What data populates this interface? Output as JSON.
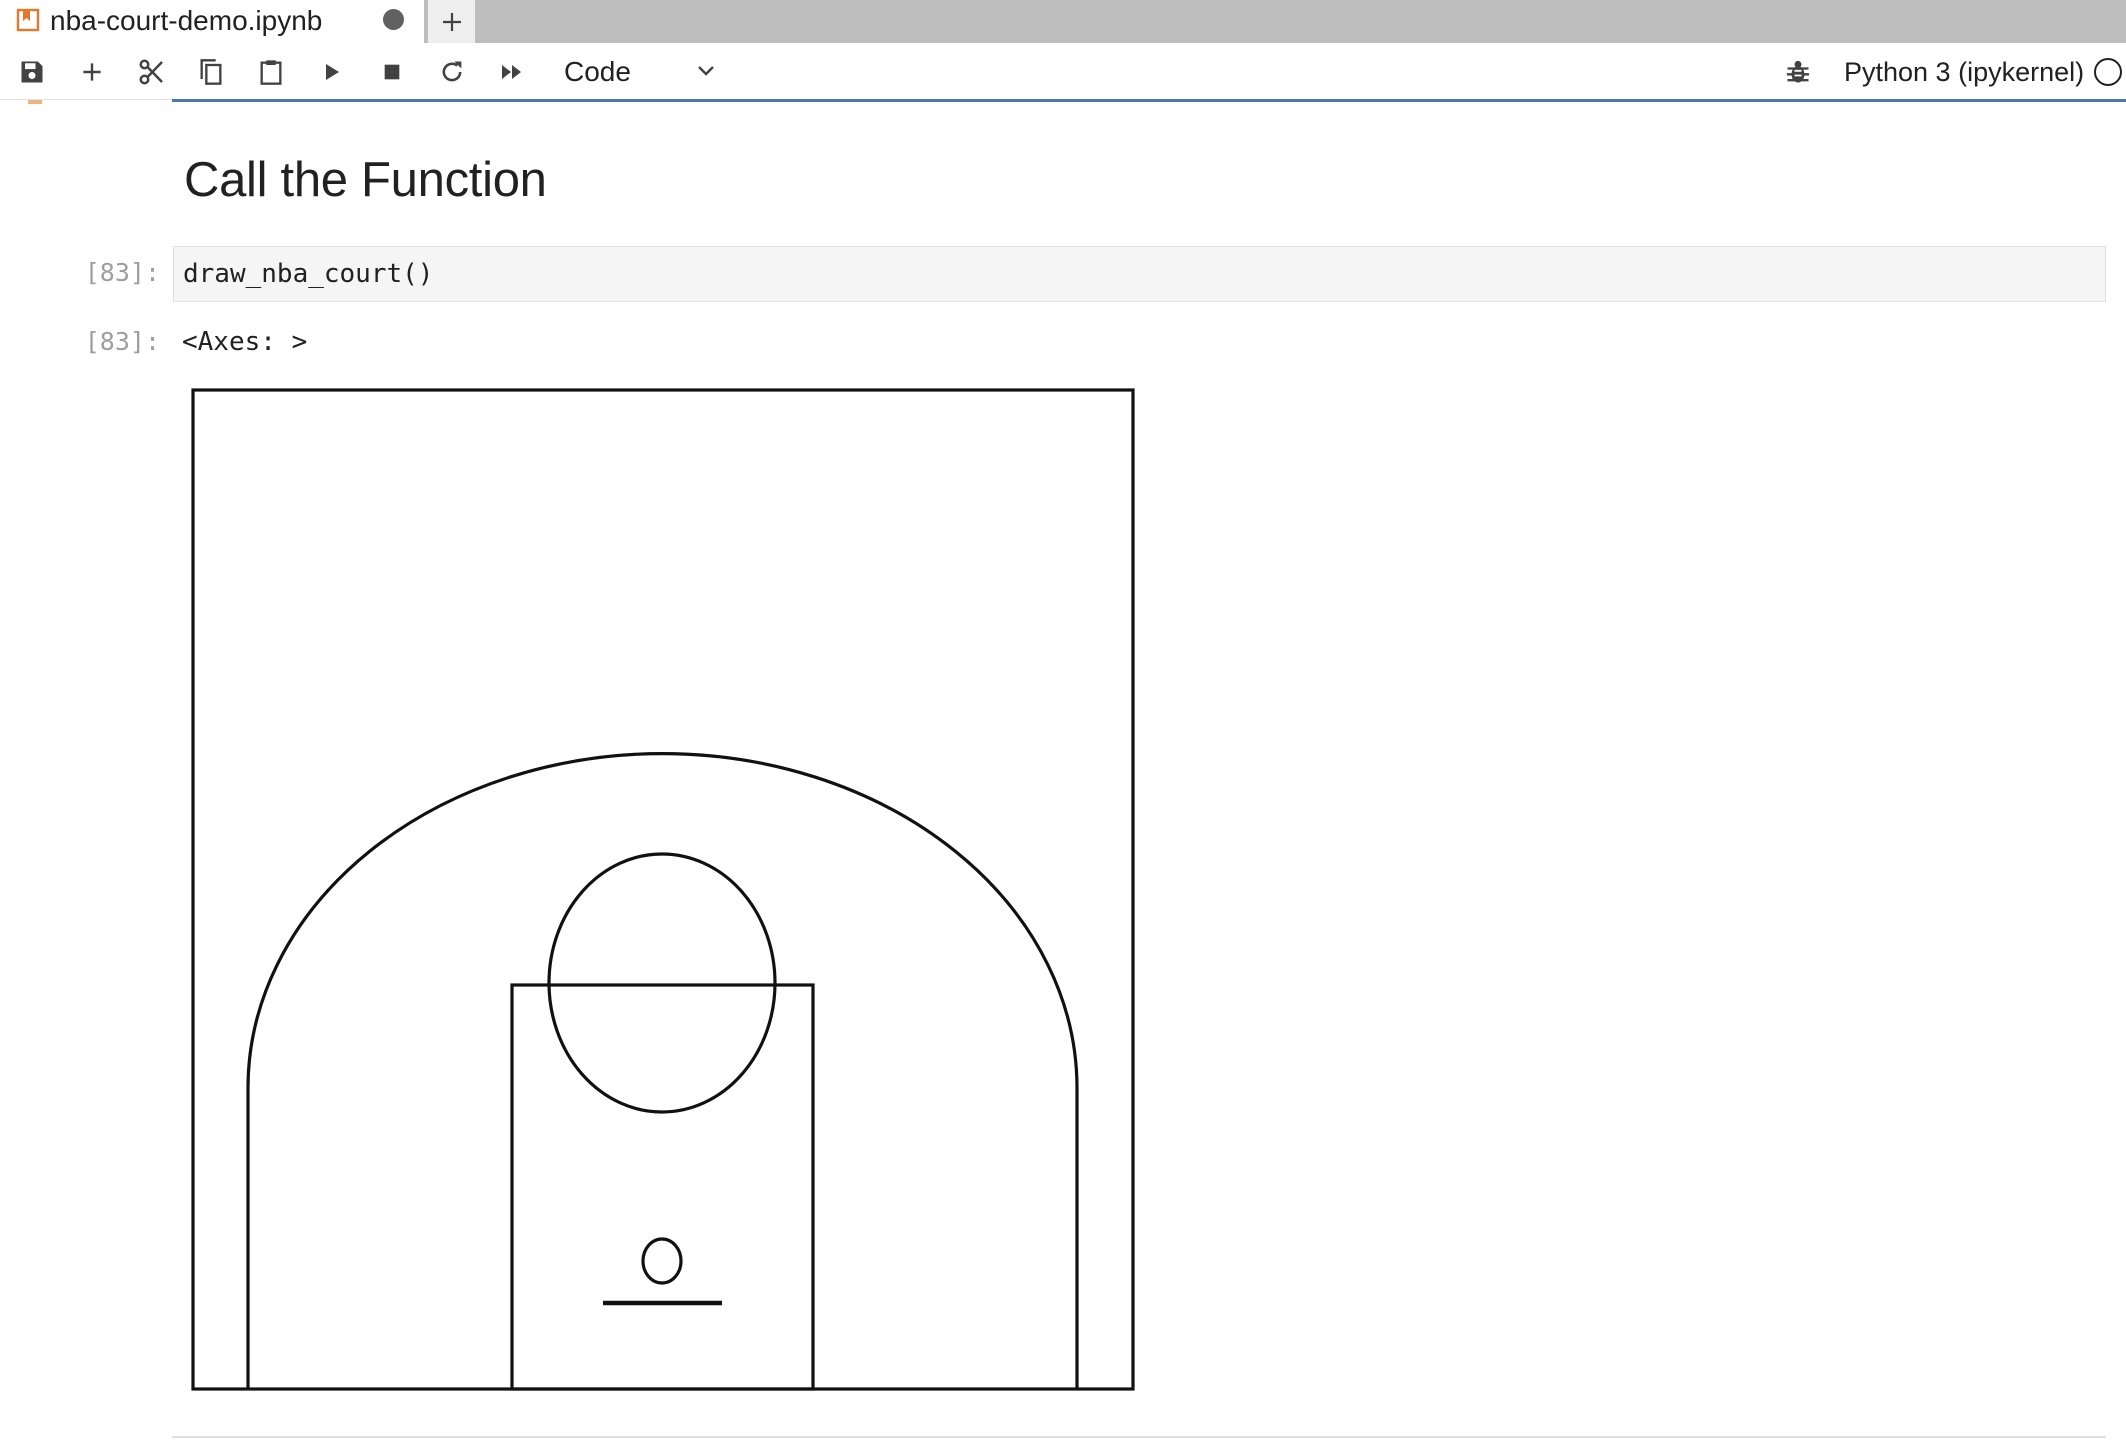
{
  "tab": {
    "title": "nba-court-demo.ipynb",
    "new_tab_label": "+"
  },
  "toolbar": {
    "buttons": [
      "save-icon",
      "add-icon",
      "cut-icon",
      "copy-icon",
      "paste-icon",
      "run-icon",
      "stop-icon",
      "restart-icon",
      "fast-forward-icon"
    ],
    "cell_type": "Code",
    "kernel": "Python 3 (ipykernel)"
  },
  "notebook": {
    "heading": "Call the Function",
    "input_prompt": "[83]:",
    "code": "draw_nba_court()",
    "output_prompt": "[83]:",
    "output_text": "<Axes: >"
  },
  "colors": {
    "accent": "#4a77b4",
    "tab_bar": "#bdbdbd",
    "code_bg": "#f5f5f5",
    "notebook_icon": "#e8772e"
  }
}
